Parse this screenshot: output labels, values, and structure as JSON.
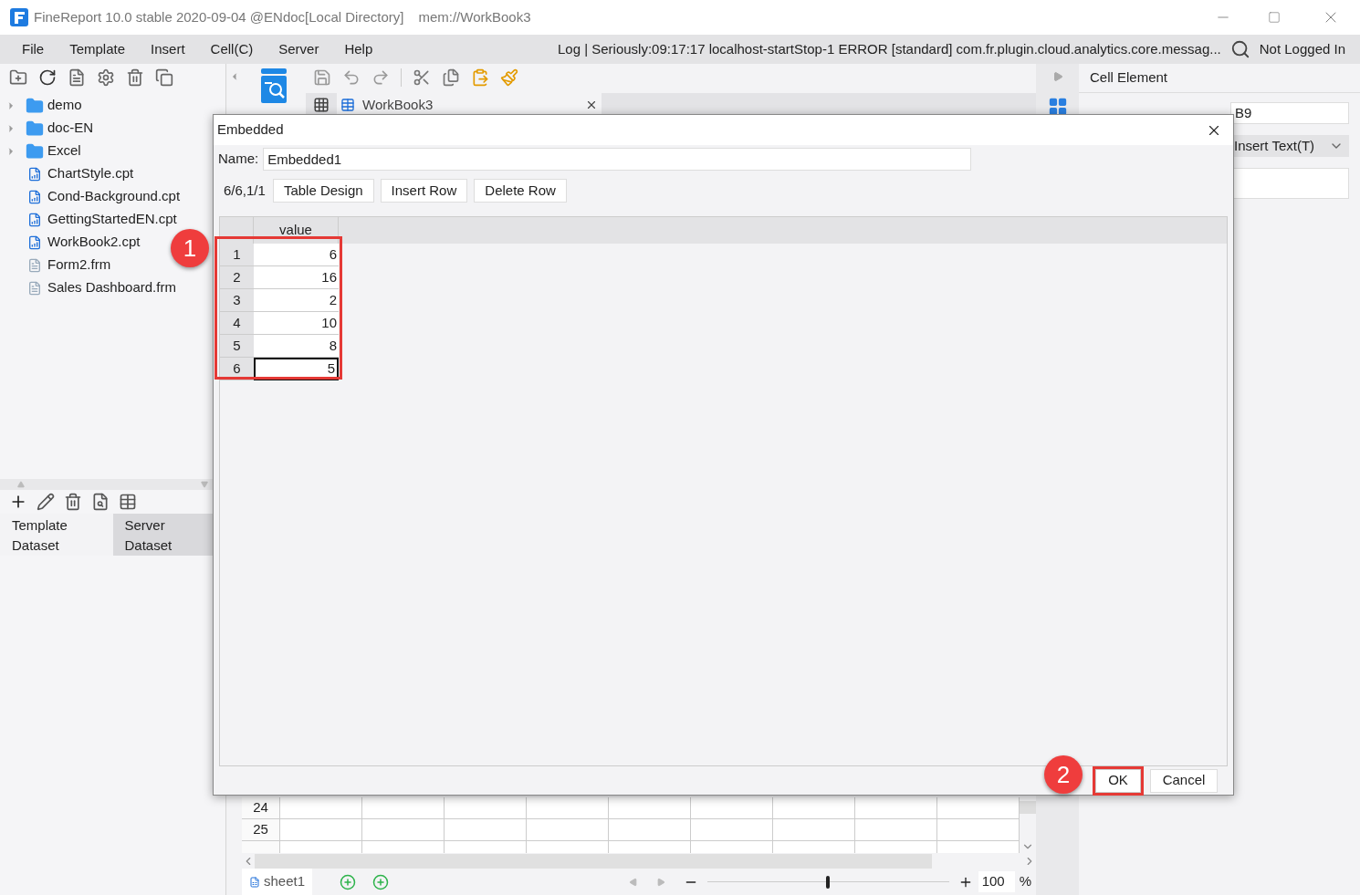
{
  "window": {
    "title": "FineReport 10.0 stable 2020-09-04 @ENdoc[Local Directory]",
    "path": "mem://WorkBook3"
  },
  "menu": [
    "File",
    "Template",
    "Insert",
    "Cell(C)",
    "Server",
    "Help"
  ],
  "log": "Log | Seriously:09:17:17 localhost-startStop-1 ERROR [standard] com.fr.plugin.cloud.analytics.core.messag...",
  "login": "Not Logged In",
  "file_tree": [
    {
      "label": "demo",
      "kind": "folder",
      "expanded": false
    },
    {
      "label": "doc-EN",
      "kind": "folder",
      "expanded": false
    },
    {
      "label": "Excel",
      "kind": "folder",
      "expanded": false
    },
    {
      "label": "ChartStyle.cpt",
      "kind": "report"
    },
    {
      "label": "Cond-Background.cpt",
      "kind": "report"
    },
    {
      "label": "GettingStartedEN.cpt",
      "kind": "report"
    },
    {
      "label": "WorkBook2.cpt",
      "kind": "report"
    },
    {
      "label": "Form2.frm",
      "kind": "form"
    },
    {
      "label": "Sales Dashboard.frm",
      "kind": "form"
    }
  ],
  "dataset_tabs": [
    {
      "label": "Template Dataset",
      "selected": true
    },
    {
      "label": "Server Dataset",
      "selected": false
    }
  ],
  "editor": {
    "tab": "WorkBook3",
    "rows": [
      "24",
      "25"
    ],
    "sheet": "sheet1",
    "zoom_slider": {
      "level": 0.5
    },
    "zoom": "100",
    "zoom_unit": "%"
  },
  "right_panel": {
    "title": "Cell Element",
    "cell": "B9",
    "insert_type": "Insert Text(T)"
  },
  "dialog": {
    "title": "Embedded",
    "name_label": "Name:",
    "name": "Embedded1",
    "position": "6/6,1/1",
    "buttons": [
      "Table Design",
      "Insert Row",
      "Delete Row"
    ],
    "column": "value",
    "rows": [
      {
        "index": "1",
        "value": "6",
        "selected": false
      },
      {
        "index": "2",
        "value": "16",
        "selected": false
      },
      {
        "index": "3",
        "value": "2",
        "selected": false
      },
      {
        "index": "4",
        "value": "10",
        "selected": false
      },
      {
        "index": "5",
        "value": "8",
        "selected": false
      },
      {
        "index": "6",
        "value": "5",
        "selected": true
      }
    ],
    "ok": "OK",
    "cancel": "Cancel"
  },
  "callouts": [
    "1",
    "2"
  ]
}
